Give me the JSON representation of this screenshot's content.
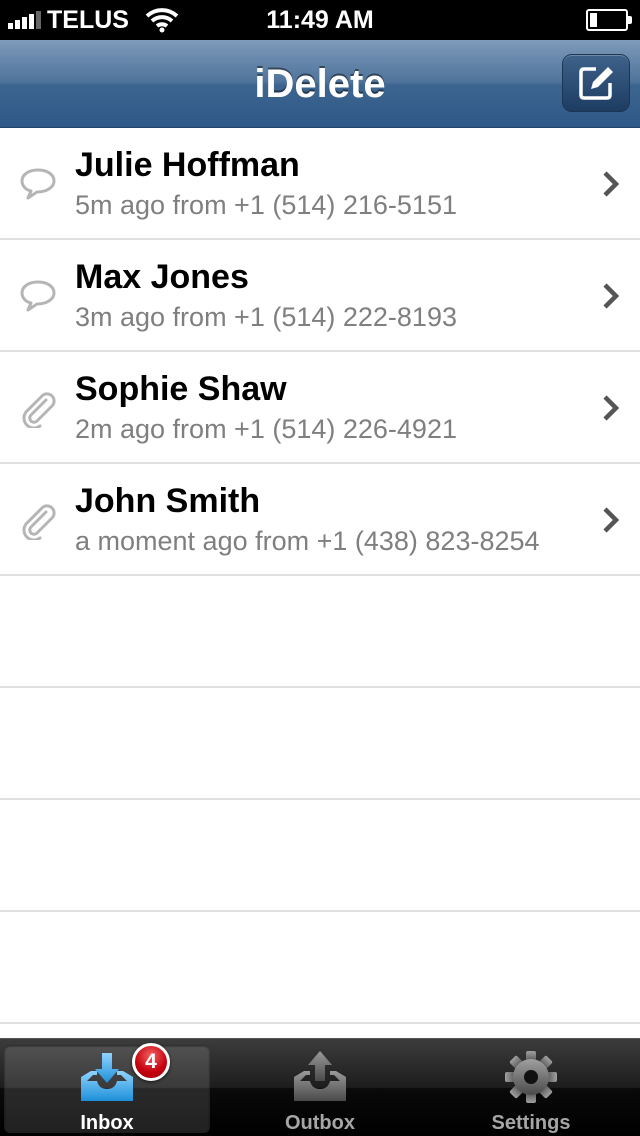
{
  "status_bar": {
    "carrier": "TELUS",
    "time": "11:49 AM",
    "signal_bars": 4,
    "battery_level": 0.2
  },
  "nav": {
    "title": "iDelete",
    "compose_icon": "compose-icon"
  },
  "messages": [
    {
      "name": "Julie Hoffman",
      "subtitle": "5m ago from +1 (514) 216-5151",
      "icon": "speech-bubble-icon"
    },
    {
      "name": "Max Jones",
      "subtitle": "3m ago from +1 (514) 222-8193",
      "icon": "speech-bubble-icon"
    },
    {
      "name": "Sophie Shaw",
      "subtitle": "2m ago from +1 (514) 226-4921",
      "icon": "paperclip-icon"
    },
    {
      "name": "John Smith",
      "subtitle": "a moment ago from +1 (438) 823-8254",
      "icon": "paperclip-icon"
    }
  ],
  "tabs": [
    {
      "label": "Inbox",
      "icon": "inbox-icon",
      "badge": "4",
      "active": true
    },
    {
      "label": "Outbox",
      "icon": "outbox-icon",
      "active": false
    },
    {
      "label": "Settings",
      "icon": "gear-icon",
      "active": false
    }
  ],
  "colors": {
    "nav_blue": "#3d6590",
    "accent_blue": "#37a7e6",
    "badge_red": "#c4000e",
    "subtitle_gray": "#7f7f7f"
  }
}
